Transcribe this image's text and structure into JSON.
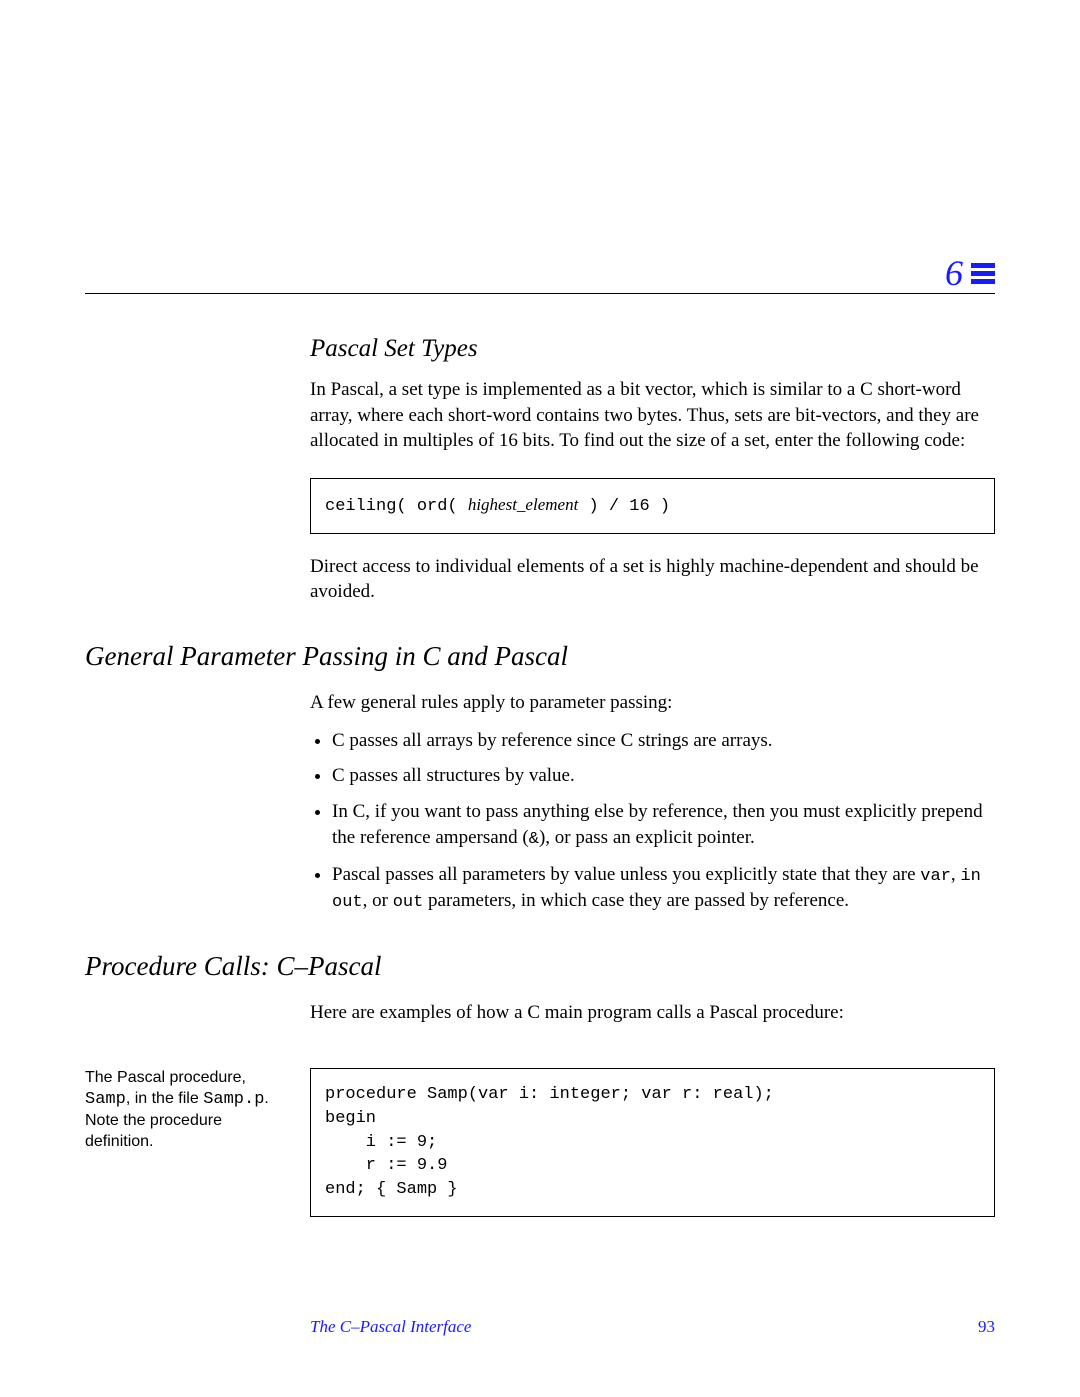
{
  "chapterNumber": "6",
  "sec1": {
    "title": "Pascal Set Types",
    "para1": "In Pascal, a set type is implemented as a bit vector, which is similar to a C short-word array, where each short-word contains two bytes.  Thus, sets are bit-vectors, and they are allocated in multiples of 16 bits.  To find out the size of a set, enter the following code:",
    "code_pre": "ceiling( ord( ",
    "code_arg": "highest_element",
    "code_post": " ) / 16 )",
    "para2": "Direct access to individual elements of a set is highly machine-dependent and should be avoided."
  },
  "sec2": {
    "title": "General Parameter Passing in C and Pascal",
    "intro": "A few general rules apply to parameter passing:",
    "b1": "C passes all arrays by reference since C strings are arrays.",
    "b2": "C passes all structures by value.",
    "b3a": "In C, if you want to pass anything else by reference, then you must explicitly prepend the reference ampersand (",
    "b3amp": "&",
    "b3b": "), or pass an explicit pointer.",
    "b4a": "Pascal passes all parameters by value unless you explicitly state that they are ",
    "b4var": "var",
    "b4b": ", ",
    "b4inout": "in  out",
    "b4c": ", or ",
    "b4out": "out",
    "b4d": " parameters, in which case they are passed by reference."
  },
  "sec3": {
    "title": "Procedure Calls: C–Pascal",
    "intro": "Here are examples of how a C main program calls a Pascal procedure:",
    "sidenote_a": "The Pascal procedure, ",
    "sidenote_samp": "Samp",
    "sidenote_b": ", in the file ",
    "sidenote_file": "Samp.p",
    "sidenote_c": ".  Note the procedure definition.",
    "code": "procedure Samp(var i: integer; var r: real);\nbegin\n    i := 9;\n    r := 9.9\nend; { Samp }"
  },
  "footer": {
    "title": "The C–Pascal Interface",
    "page": "93"
  }
}
